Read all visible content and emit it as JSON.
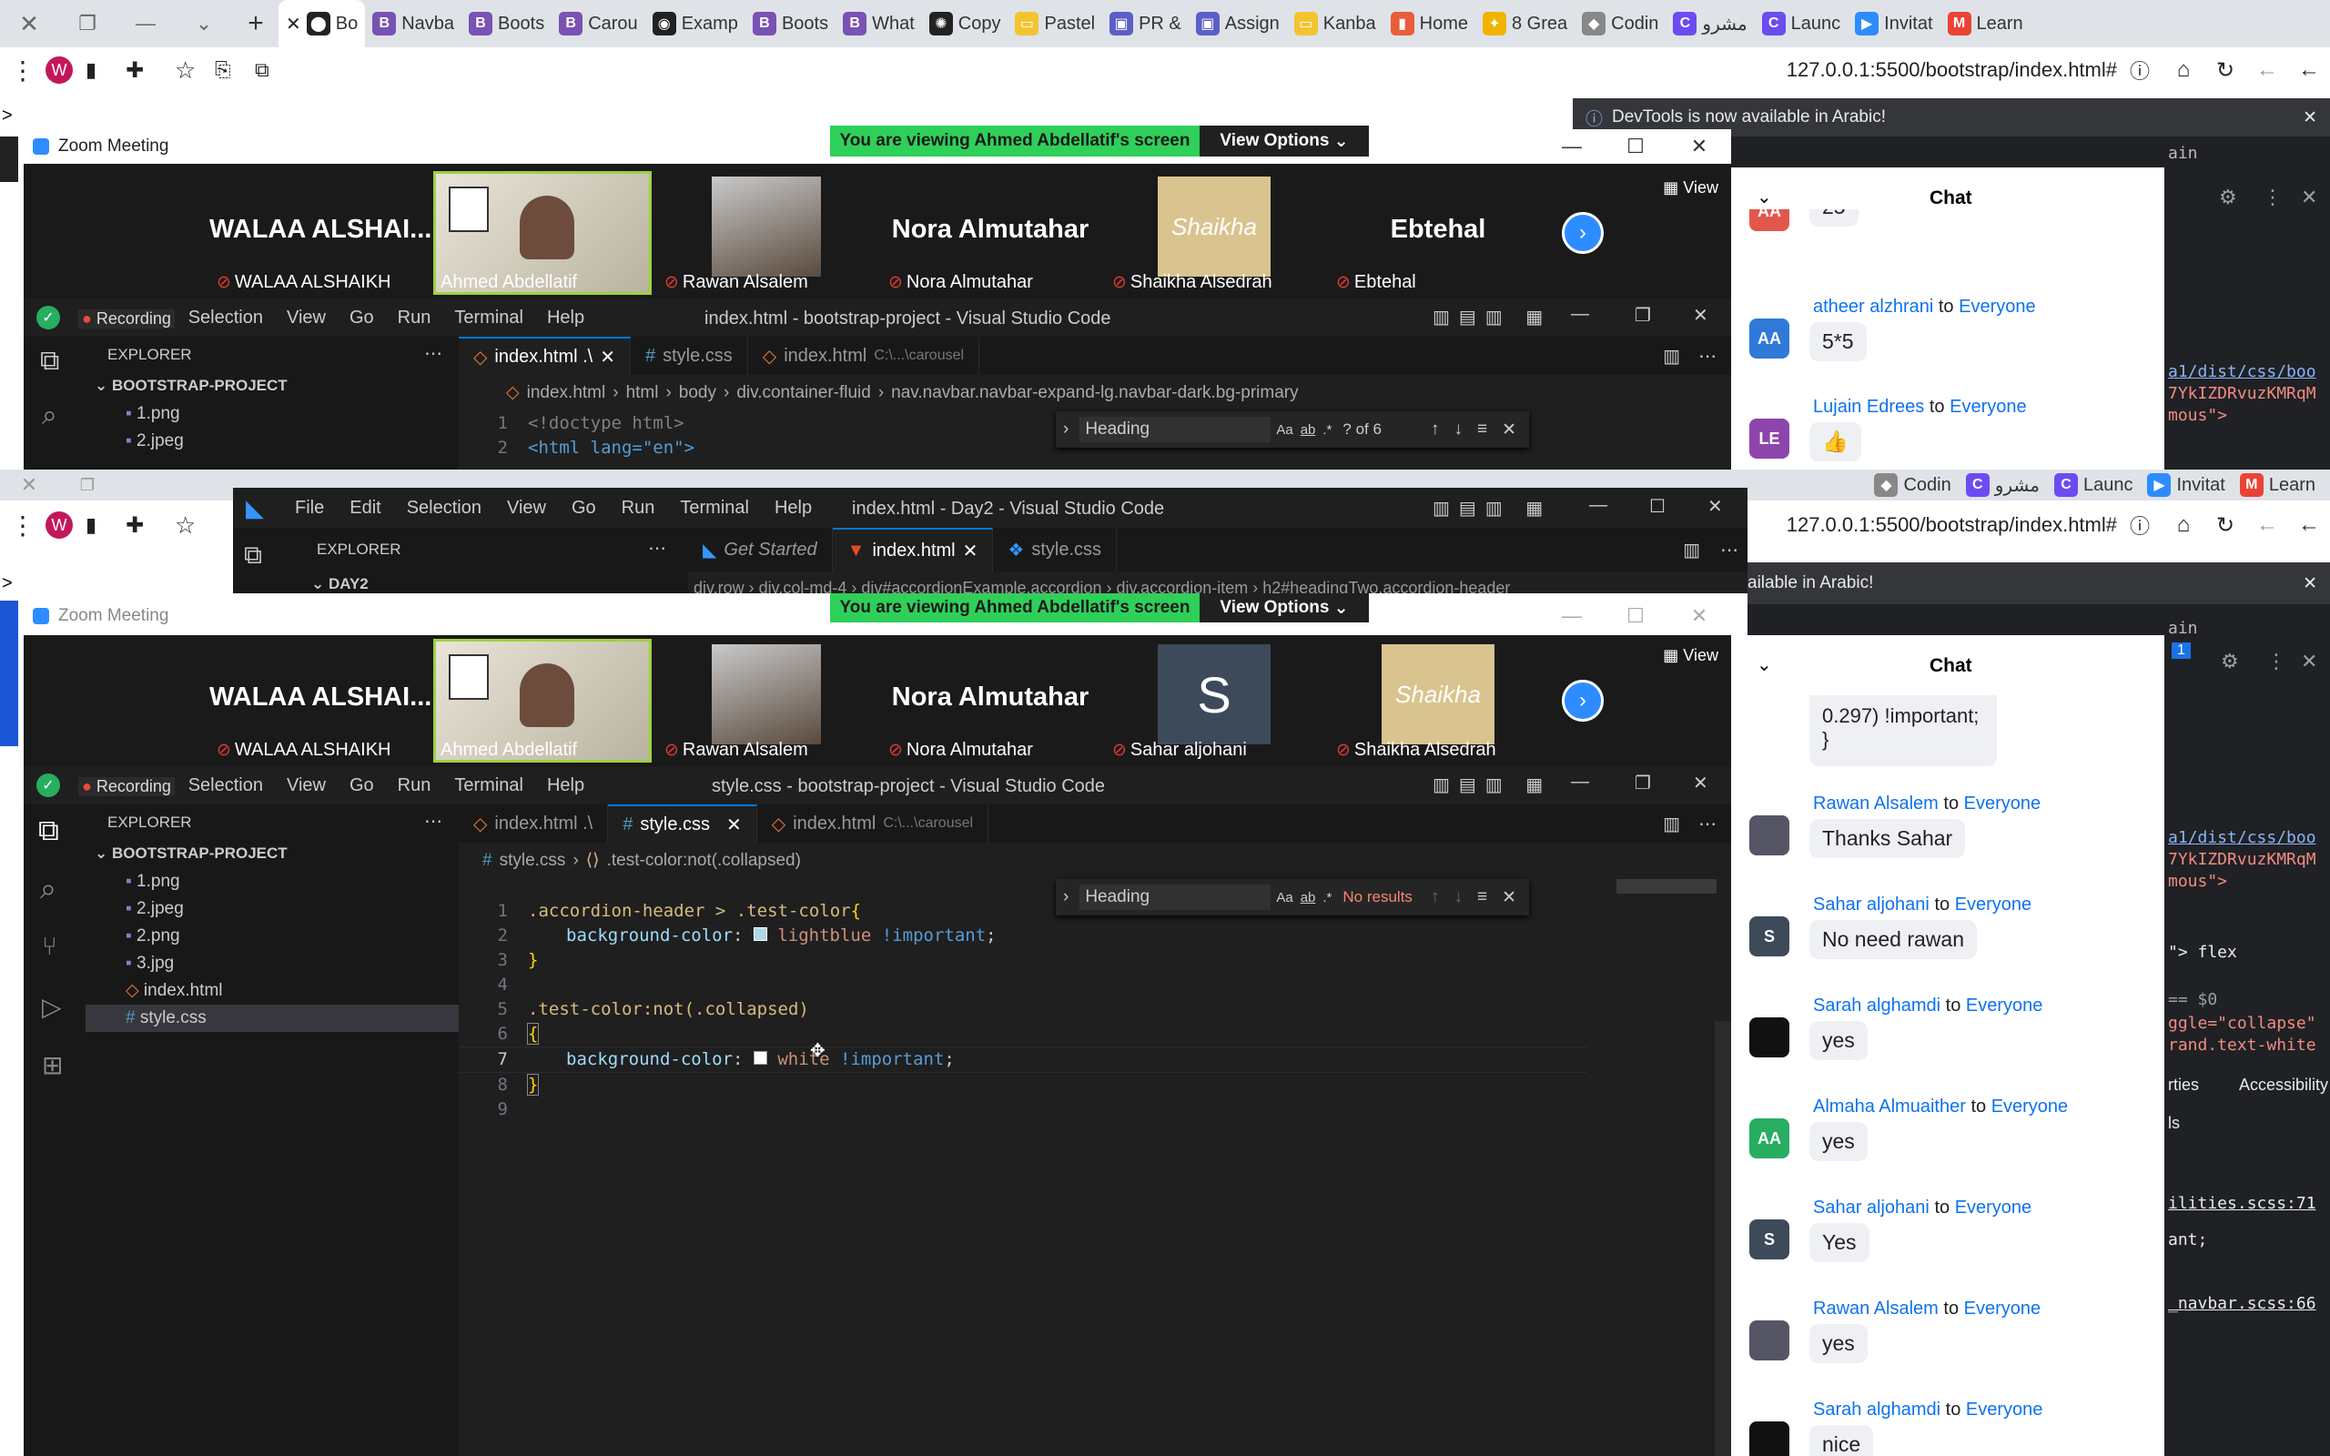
{
  "browser": {
    "tabs": [
      {
        "label": "Bo",
        "color": "#222",
        "glyph": "⬤"
      },
      {
        "label": "Navba",
        "color": "#7952b3",
        "glyph": "B"
      },
      {
        "label": "Boots",
        "color": "#7952b3",
        "glyph": "B"
      },
      {
        "label": "Carou",
        "color": "#7952b3",
        "glyph": "B"
      },
      {
        "label": "Examp",
        "color": "#222",
        "glyph": "◉"
      },
      {
        "label": "Boots",
        "color": "#7952b3",
        "glyph": "B"
      },
      {
        "label": "What",
        "color": "#7952b3",
        "glyph": "B"
      },
      {
        "label": "Copy",
        "color": "#222",
        "glyph": "✺"
      },
      {
        "label": "Pastel",
        "color": "#f4c430",
        "glyph": "▭"
      },
      {
        "label": "PR &",
        "color": "#5b5fc7",
        "glyph": "▣"
      },
      {
        "label": "Assign",
        "color": "#5b5fc7",
        "glyph": "▣"
      },
      {
        "label": "Kanba",
        "color": "#f4c430",
        "glyph": "▭"
      },
      {
        "label": "Home",
        "color": "#e85d3a",
        "glyph": "▮"
      },
      {
        "label": "8 Grea",
        "color": "#f0b400",
        "glyph": "✦"
      },
      {
        "label": "Codin",
        "color": "#888",
        "glyph": "◆"
      },
      {
        "label": "مشرو",
        "color": "#6c4cf1",
        "glyph": "C"
      },
      {
        "label": "Launc",
        "color": "#6c4cf1",
        "glyph": "C"
      },
      {
        "label": "Invitat",
        "color": "#2d8cff",
        "glyph": "▶"
      },
      {
        "label": "Learn",
        "color": "#ea4335",
        "glyph": "M"
      }
    ],
    "tabs2": [
      {
        "label": "Codin",
        "color": "#888",
        "glyph": "◆"
      },
      {
        "label": "مشرو",
        "color": "#6c4cf1",
        "glyph": "C"
      },
      {
        "label": "Launc",
        "color": "#6c4cf1",
        "glyph": "C"
      },
      {
        "label": "Invitat",
        "color": "#2d8cff",
        "glyph": "▶"
      },
      {
        "label": "Learn",
        "color": "#ea4335",
        "glyph": "M"
      }
    ],
    "url": "127.0.0.1:5500/bootstrap/index.html#",
    "profile_initial": "W",
    "devtools_notice": "DevTools is now available in Arabic!",
    "devtools_notice_cut": "ailable in Arabic!",
    "prompt": ">"
  },
  "zoom": {
    "title": "Zoom Meeting",
    "banner": "You are viewing Ahmed Abdellatif's screen",
    "view_options": "View Options",
    "view_label": "View",
    "chat_title": "Chat",
    "participants_top": [
      {
        "big": "WALAA  ALSHAI...",
        "name": "WALAA ALSHAIKH",
        "muted": true,
        "kind": "text"
      },
      {
        "big": "",
        "name": "Ahmed Abdellatif",
        "muted": false,
        "kind": "video"
      },
      {
        "big": "",
        "name": "Rawan Alsalem",
        "muted": true,
        "kind": "avatar"
      },
      {
        "big": "Nora Almutahar",
        "name": "Nora Almutahar",
        "muted": true,
        "kind": "text"
      },
      {
        "big": "Shaikha",
        "name": "Shaikha Alsedrah",
        "muted": true,
        "kind": "logo"
      },
      {
        "big": "Ebtehal",
        "name": "Ebtehal",
        "muted": true,
        "kind": "text"
      }
    ],
    "participants_bottom": [
      {
        "big": "WALAA  ALSHAI...",
        "name": "WALAA ALSHAIKH",
        "muted": true,
        "kind": "text"
      },
      {
        "big": "",
        "name": "Ahmed Abdellatif",
        "muted": false,
        "kind": "video"
      },
      {
        "big": "",
        "name": "Rawan Alsalem",
        "muted": true,
        "kind": "avatar"
      },
      {
        "big": "Nora Almutahar",
        "name": "Nora Almutahar",
        "muted": true,
        "kind": "text"
      },
      {
        "big": "S",
        "name": "Sahar aljohani",
        "muted": true,
        "kind": "letter"
      },
      {
        "big": "Shaikha",
        "name": "Shaikha Alsedrah",
        "muted": true,
        "kind": "logo"
      }
    ],
    "chat_top": [
      {
        "sender": "",
        "to": "",
        "initials": "AA",
        "avcolor": "#e2574c",
        "text": "25"
      },
      {
        "sender": "atheer alzhrani",
        "to": "Everyone",
        "initials": "AA",
        "avcolor": "#2f7ad8",
        "text": "5*5"
      },
      {
        "sender": "Lujain Edrees",
        "to": "Everyone",
        "initials": "LE",
        "avcolor": "#8e44ad",
        "text": "👍"
      }
    ],
    "chat_partial_1": "0.297) !important;",
    "chat_partial_2": "}",
    "chat_bottom": [
      {
        "sender": "Rawan Alsalem",
        "to": "Everyone",
        "initials": "",
        "avcolor": "#556",
        "text": "Thanks Sahar"
      },
      {
        "sender": "Sahar aljohani",
        "to": "Everyone",
        "initials": "S",
        "avcolor": "#3d4a5a",
        "text": "No need rawan"
      },
      {
        "sender": "Sarah alghamdi",
        "to": "Everyone",
        "initials": "",
        "avcolor": "#111",
        "text": "yes"
      },
      {
        "sender": "Almaha Almuaither",
        "to": "Everyone",
        "initials": "AA",
        "avcolor": "#27ae60",
        "text": "yes"
      },
      {
        "sender": "Sahar aljohani",
        "to": "Everyone",
        "initials": "S",
        "avcolor": "#3d4a5a",
        "text": "Yes"
      },
      {
        "sender": "Rawan Alsalem",
        "to": "Everyone",
        "initials": "",
        "avcolor": "#556",
        "text": "yes"
      },
      {
        "sender": "Sarah alghamdi",
        "to": "Everyone",
        "initials": "",
        "avcolor": "#111",
        "text": "nice"
      }
    ]
  },
  "vscode_top": {
    "title": "index.html - bootstrap-project - Visual Studio Code",
    "menu": [
      "File",
      "Edit",
      "Selection",
      "View",
      "Go",
      "Run",
      "Terminal",
      "Help"
    ],
    "recording": "Recording",
    "explorer": "EXPLORER",
    "project": "BOOTSTRAP-PROJECT",
    "files": [
      "1.png",
      "2.jpeg"
    ],
    "tabs": [
      "index.html .\\",
      "style.css",
      "index.html"
    ],
    "tab3_path": "C:\\...\\carousel",
    "breadcrumb": [
      "index.html",
      "html",
      "body",
      "div.container-fluid",
      "nav.navbar.navbar-expand-lg.navbar-dark.bg-primary"
    ],
    "find_text": "Heading",
    "find_result": "? of 6",
    "lines": [
      "<!doctype html>",
      "<html lang=\"en\">"
    ]
  },
  "vscode_day2": {
    "title": "index.html - Day2 - Visual Studio Code",
    "menu": [
      "File",
      "Edit",
      "Selection",
      "View",
      "Go",
      "Run",
      "Terminal",
      "Help"
    ],
    "explorer": "EXPLORER",
    "folder": "DAY2",
    "tabs": [
      "Get Started",
      "index.html",
      "style.css"
    ],
    "breadcrumb": "div.row  ›  div.col-md-4  ›  div#accordionExample.accordion  ›  div.accordion-item  ›  h2#headingTwo.accordion-header"
  },
  "vscode_main": {
    "title": "style.css - bootstrap-project - Visual Studio Code",
    "menu": [
      "File",
      "Edit",
      "Selection",
      "View",
      "Go",
      "Run",
      "Terminal",
      "Help"
    ],
    "recording": "Recording",
    "explorer": "EXPLORER",
    "project": "BOOTSTRAP-PROJECT",
    "files": [
      {
        "name": "1.png",
        "type": "img"
      },
      {
        "name": "2.jpeg",
        "type": "img"
      },
      {
        "name": "2.png",
        "type": "img"
      },
      {
        "name": "3.jpg",
        "type": "img"
      },
      {
        "name": "index.html",
        "type": "html"
      },
      {
        "name": "style.css",
        "type": "css"
      }
    ],
    "tabs": [
      "index.html .\\",
      "style.css",
      "index.html"
    ],
    "tab3_path": "C:\\...\\carousel",
    "breadcrumb_file": "style.css",
    "breadcrumb_symbol": ".test-color:not(.collapsed)",
    "find_text": "Heading",
    "find_result": "No results",
    "line_numbers": [
      "1",
      "2",
      "3",
      "4",
      "5",
      "6",
      "7",
      "8",
      "9"
    ]
  },
  "devtools": {
    "lines": [
      "ain",
      "1",
      "a1/dist/css/boo",
      "7YkIZDRvuzKMRqM",
      "mous\">",
      "\"> flex",
      "== $0",
      "ggle=\"collapse\"",
      "rand.text-white",
      "rties",
      "Accessibility",
      "ls",
      "ilities.scss:71",
      "ant;",
      "_navbar.scss:66"
    ]
  }
}
